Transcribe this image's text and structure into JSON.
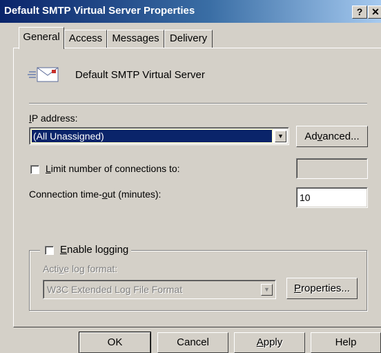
{
  "window": {
    "title": "Default SMTP Virtual Server Properties",
    "help_label": "?",
    "close_label": "✕"
  },
  "tabs": [
    {
      "label": "General",
      "active": true
    },
    {
      "label": "Access",
      "active": false
    },
    {
      "label": "Messages",
      "active": false
    },
    {
      "label": "Delivery",
      "active": false
    }
  ],
  "general": {
    "server_name": "Default SMTP Virtual Server",
    "ip_label_u": "I",
    "ip_label_rest": "P address:",
    "ip_value": "(All Unassigned)",
    "advanced_pre": "Ad",
    "advanced_u": "v",
    "advanced_post": "anced...",
    "limit_u": "L",
    "limit_rest": "imit number of connections to:",
    "limit_checked": false,
    "limit_value": "",
    "timeout_pre": "Connection time-",
    "timeout_u": "o",
    "timeout_post": "ut (minutes):",
    "timeout_value": "10",
    "logging_u": "E",
    "logging_rest": "nable logging",
    "logging_checked": false,
    "log_format_pre": "Acti",
    "log_format_u": "v",
    "log_format_post": "e log format:",
    "log_format_value": "W3C Extended Log File Format",
    "properties_u": "P",
    "properties_rest": "roperties..."
  },
  "buttons": {
    "ok": "OK",
    "cancel": "Cancel",
    "apply_u": "A",
    "apply_rest": "pply",
    "help": "Help"
  },
  "colors": {
    "dialog_face": "#d4d0c8",
    "title_gradient_start": "#0a246a",
    "title_gradient_end": "#a6caf0",
    "selection": "#0a246a",
    "disabled_text": "#808080"
  },
  "icons": {
    "server": "smtp-server-envelope-icon",
    "dropdown": "chevron-down-icon"
  }
}
